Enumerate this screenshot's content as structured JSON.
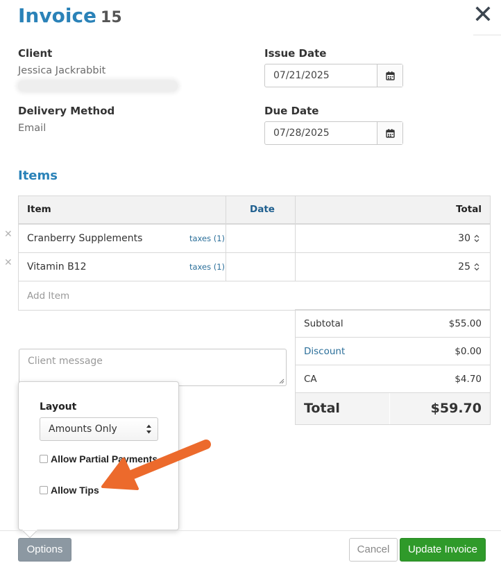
{
  "header": {
    "title": "Invoice",
    "number": "15"
  },
  "client": {
    "label": "Client",
    "name": "Jessica Jackrabbit"
  },
  "delivery": {
    "label": "Delivery Method",
    "value": "Email"
  },
  "issue_date": {
    "label": "Issue Date",
    "value": "07/21/2025"
  },
  "due_date": {
    "label": "Due Date",
    "value": "07/28/2025"
  },
  "items_section": {
    "title": "Items",
    "columns": {
      "item": "Item",
      "date": "Date",
      "total": "Total"
    },
    "rows": [
      {
        "name": "Cranberry Supplements",
        "taxes": "taxes (1)",
        "total": "30"
      },
      {
        "name": "Vitamin B12",
        "taxes": "taxes (1)",
        "total": "25"
      }
    ],
    "add_item_placeholder": "Add Item"
  },
  "totals": {
    "subtotal_label": "Subtotal",
    "subtotal": "$55.00",
    "discount_label": "Discount",
    "discount": "$0.00",
    "tax_label": "CA",
    "tax": "$4.70",
    "total_label": "Total",
    "total": "$59.70"
  },
  "message": {
    "placeholder": "Client message"
  },
  "options_popover": {
    "layout_label": "Layout",
    "layout_value": "Amounts Only",
    "allow_partial_label": "Allow Partial Payments",
    "allow_tips_label": "Allow Tips"
  },
  "footer": {
    "options_label": "Options",
    "cancel_label": "Cancel",
    "update_label": "Update Invoice"
  },
  "icons": {
    "close": "close-icon",
    "calendar": "calendar-icon",
    "remove": "remove-icon",
    "spinner": "spinner-icon"
  },
  "colors": {
    "accent": "#2a82b8",
    "link": "#2a6e99",
    "update_green": "#2f9a2a",
    "options_gray": "#8c98a2",
    "arrow_orange": "#ec6a2c"
  }
}
